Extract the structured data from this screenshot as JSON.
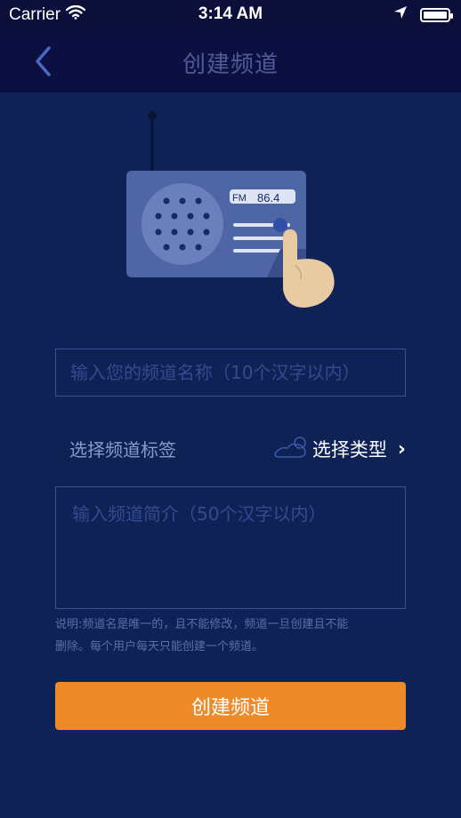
{
  "status_bar": {
    "carrier": "Carrier",
    "time": "3:14 AM"
  },
  "nav": {
    "title": "创建频道"
  },
  "illustration": {
    "fm_label": "FM",
    "frequency": "86.4"
  },
  "form": {
    "name_placeholder": "输入您的频道名称（10个汉字以内）",
    "tag_label": "选择频道标签",
    "tag_select_text": "选择类型",
    "intro_placeholder": "输入频道简介（50个汉字以内）",
    "note": "说明:频道名是唯一的，且不能修改，频道一旦创建且不能删除。每个用户每天只能创建一个频道。",
    "create_button": "创建频道"
  },
  "colors": {
    "background": "#0f2256",
    "accent": "#ed8a2a",
    "field_border": "#3a4f95"
  }
}
